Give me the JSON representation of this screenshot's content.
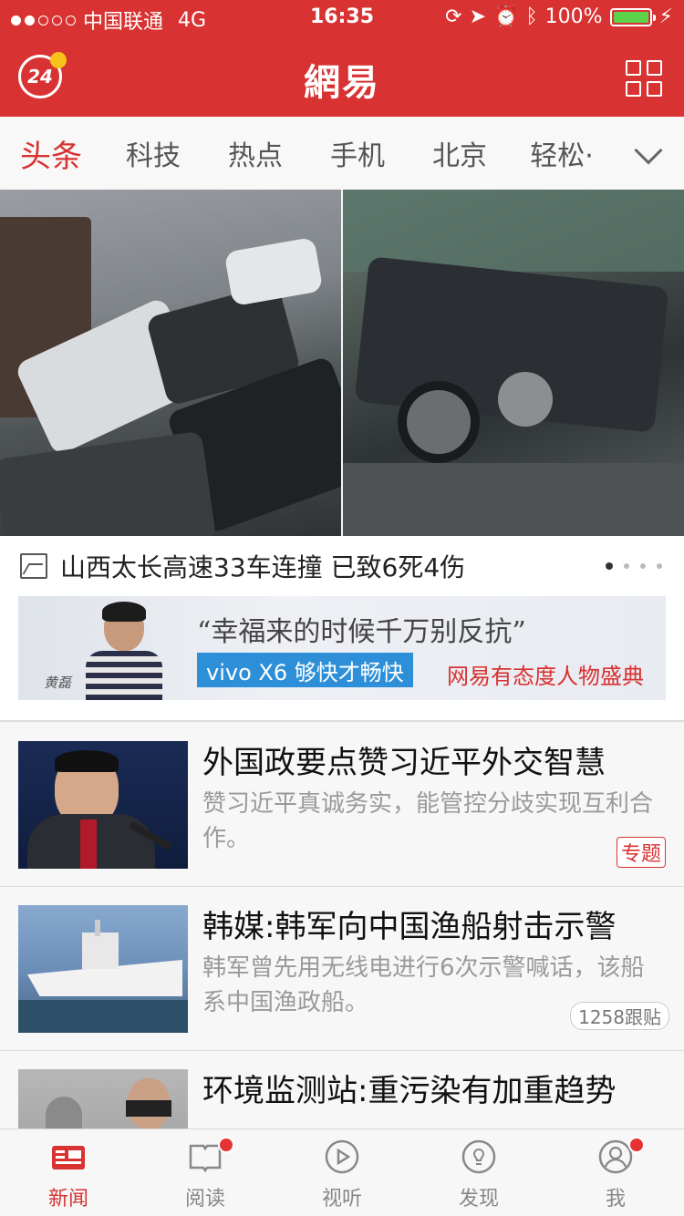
{
  "status": {
    "carrier": "中国联通",
    "network": "4G",
    "time": "16:35",
    "battery": "100%"
  },
  "header": {
    "badge_24": "24",
    "logo": "網易"
  },
  "tabs": [
    "头条",
    "科技",
    "热点",
    "手机",
    "北京",
    "轻松·"
  ],
  "hero": {
    "caption": "山西太长高速33车连撞  已致6死4伤"
  },
  "ad": {
    "signature": "黄磊",
    "slogan": "“幸福来的时候千万别反抗”",
    "product": "vivo X6 够快才畅快",
    "event": "网易有态度人物盛典"
  },
  "news": [
    {
      "title": "外国政要点赞习近平外交智慧",
      "desc": "赞习近平真诚务实，能管控分歧实现互利合作。",
      "tag": "专题"
    },
    {
      "title": "韩媒:韩军向中国渔船射击示警",
      "desc": "韩军曾先用无线电进行6次示警喊话，该船系中国渔政船。",
      "tag": "1258跟贴"
    },
    {
      "title": "环境监测站:重污染有加重趋势",
      "desc": "",
      "tag": ""
    }
  ],
  "tabbar": [
    {
      "label": "新闻",
      "icon": "news-icon"
    },
    {
      "label": "阅读",
      "icon": "book-icon"
    },
    {
      "label": "视听",
      "icon": "play-icon"
    },
    {
      "label": "发现",
      "icon": "bulb-icon"
    },
    {
      "label": "我",
      "icon": "user-icon"
    }
  ],
  "colors": {
    "brand": "#d93232",
    "battery": "#5cd14a",
    "badge": "#f8c21b"
  }
}
